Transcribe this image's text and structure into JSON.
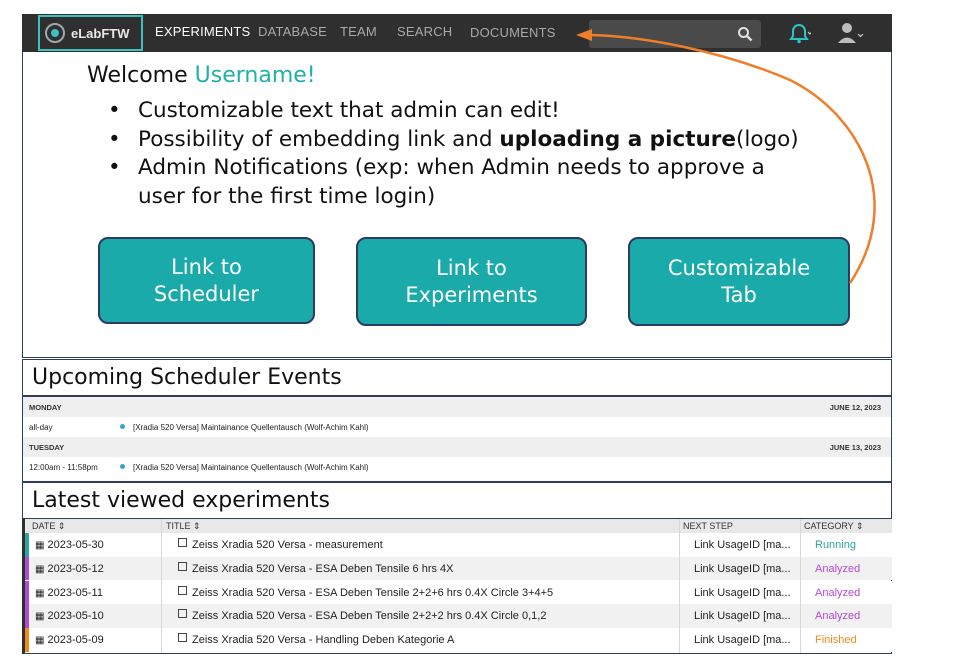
{
  "nav": {
    "logo": "eLabFTW",
    "items": [
      "EXPERIMENTS",
      "DATABASE",
      "TEAM",
      "SEARCH",
      "DOCUMENTS"
    ]
  },
  "welcome": {
    "prefix": "Welcome ",
    "username": "Username!"
  },
  "bullets": [
    "Customizable text that admin can edit!",
    "Possibility of embedding link and ",
    "uploading a picture",
    "(logo)",
    "Admin Notifications (exp: when Admin needs to approve a user for the first time login)"
  ],
  "tiles": [
    "Link to Scheduler",
    "Link to Experiments",
    "Customizable Tab"
  ],
  "scheduler": {
    "title": "Upcoming Scheduler Events",
    "days": [
      {
        "day": "MONDAY",
        "date": "JUNE 12, 2023",
        "time": "all-day",
        "event": "[Xradia 520 Versa] Maintainance Quellentausch (Wolf-Achim Kahl)"
      },
      {
        "day": "TUESDAY",
        "date": "JUNE 13, 2023",
        "time": "12:00am - 11:58pm",
        "event": "[Xradia 520 Versa] Maintainance Quellentausch (Wolf-Achim Kahl)"
      }
    ]
  },
  "experiments": {
    "title": "Latest viewed experiments",
    "columns": [
      "DATE ⇕",
      "TITLE ⇕",
      "NEXT STEP",
      "CATEGORY ⇕"
    ],
    "rows": [
      {
        "date": "2023-05-30",
        "title": "Zeiss Xradia 520 Versa - measurement",
        "next": "Link UsageID [ma...",
        "category": "Running",
        "color": "#2aa6a0"
      },
      {
        "date": "2023-05-12",
        "title": "Zeiss Xradia 520 Versa - ESA Deben Tensile 6 hrs 4X",
        "next": "Link UsageID [ma...",
        "category": "Analyzed",
        "color": "#b04ad8"
      },
      {
        "date": "2023-05-11",
        "title": "Zeiss Xradia 520 Versa - ESA Deben Tensile 2+2+6 hrs 0.4X Circle 3+4+5",
        "next": "Link UsageID [ma...",
        "category": "Analyzed",
        "color": "#b04ad8"
      },
      {
        "date": "2023-05-10",
        "title": "Zeiss Xradia 520 Versa - ESA Deben Tensile 2+2+2 hrs 0.4X Circle 0,1,2",
        "next": "Link UsageID [ma...",
        "category": "Analyzed",
        "color": "#b04ad8"
      },
      {
        "date": "2023-05-09",
        "title": "Zeiss Xradia 520 Versa - Handling Deben Kategorie A",
        "next": "Link UsageID [ma...",
        "category": "Finished",
        "color": "#f08a1c"
      }
    ]
  },
  "colors": {
    "accent": "#1aaaa9",
    "nav_bg": "#2f2f2f",
    "arrow": "#ef7d2a"
  }
}
